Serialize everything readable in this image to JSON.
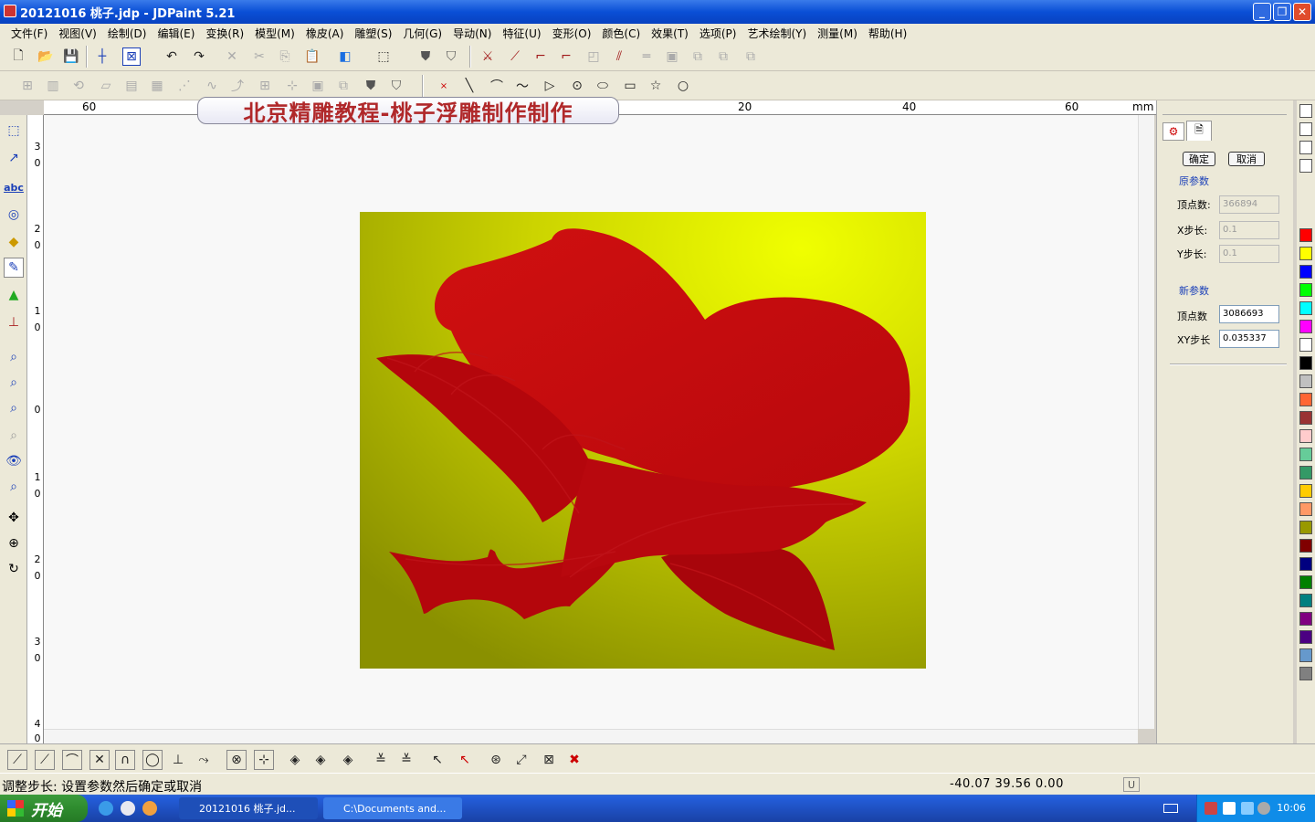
{
  "window": {
    "title": "20121016 桃子.jdp - JDPaint 5.21"
  },
  "menu": [
    "文件(F)",
    "视图(V)",
    "绘制(D)",
    "编辑(E)",
    "变换(R)",
    "模型(M)",
    "橡皮(A)",
    "雕塑(S)",
    "几何(G)",
    "导动(N)",
    "特征(U)",
    "变形(O)",
    "颜色(C)",
    "效果(T)",
    "选项(P)",
    "艺术绘制(Y)",
    "测量(M)",
    "帮助(H)"
  ],
  "ruler": {
    "h_labels": [
      "60",
      "20",
      "40",
      "60"
    ],
    "unit": "mm",
    "v_labels": [
      "3",
      "0",
      "2",
      "0",
      "1",
      "0",
      "0",
      "1",
      "0",
      "2",
      "0",
      "3",
      "0",
      "4",
      "0"
    ]
  },
  "banner": {
    "text": "北京精雕教程-桃子浮雕制作制作"
  },
  "panel": {
    "ok_label": "确定",
    "cancel_label": "取消",
    "orig_group": "原参数",
    "vertex_label": "顶点数:",
    "vertex_value": "366894",
    "xstep_label": "X步长:",
    "xstep_value": "0.1",
    "ystep_label": "Y步长:",
    "ystep_value": "0.1",
    "new_group": "新参数",
    "new_vertex_label": "顶点数",
    "new_vertex_value": "3086693",
    "xystep_label": "XY步长",
    "xystep_value": "0.035337"
  },
  "palette": [
    "#ff0000",
    "#ffff00",
    "#0000ff",
    "#00ff00",
    "#00ffff",
    "#ff00ff",
    "#ffffff",
    "#000000",
    "#c0c0c0",
    "#ff6633",
    "#993333",
    "#ffcccc",
    "#66cc99",
    "#339966",
    "#ffcc00",
    "#ff9966",
    "#999900",
    "#800000",
    "#000080",
    "#008000",
    "#008080",
    "#800080",
    "#4b0082",
    "#6699cc",
    "#808080"
  ],
  "status": {
    "message": "调整步长: 设置参数然后确定或取消",
    "coords": "-40.07  39.56  0.00",
    "mode": "U"
  },
  "taskbar": {
    "start": "开始",
    "task1": "20121016 桃子.jd...",
    "task2": "C:\\Documents and...",
    "clock": "10:06"
  },
  "colors": {
    "fruit": "#d40a0a",
    "leaf": "#b8070d",
    "bg_bright": "#e8f000",
    "bg_dark": "#8c9400"
  }
}
